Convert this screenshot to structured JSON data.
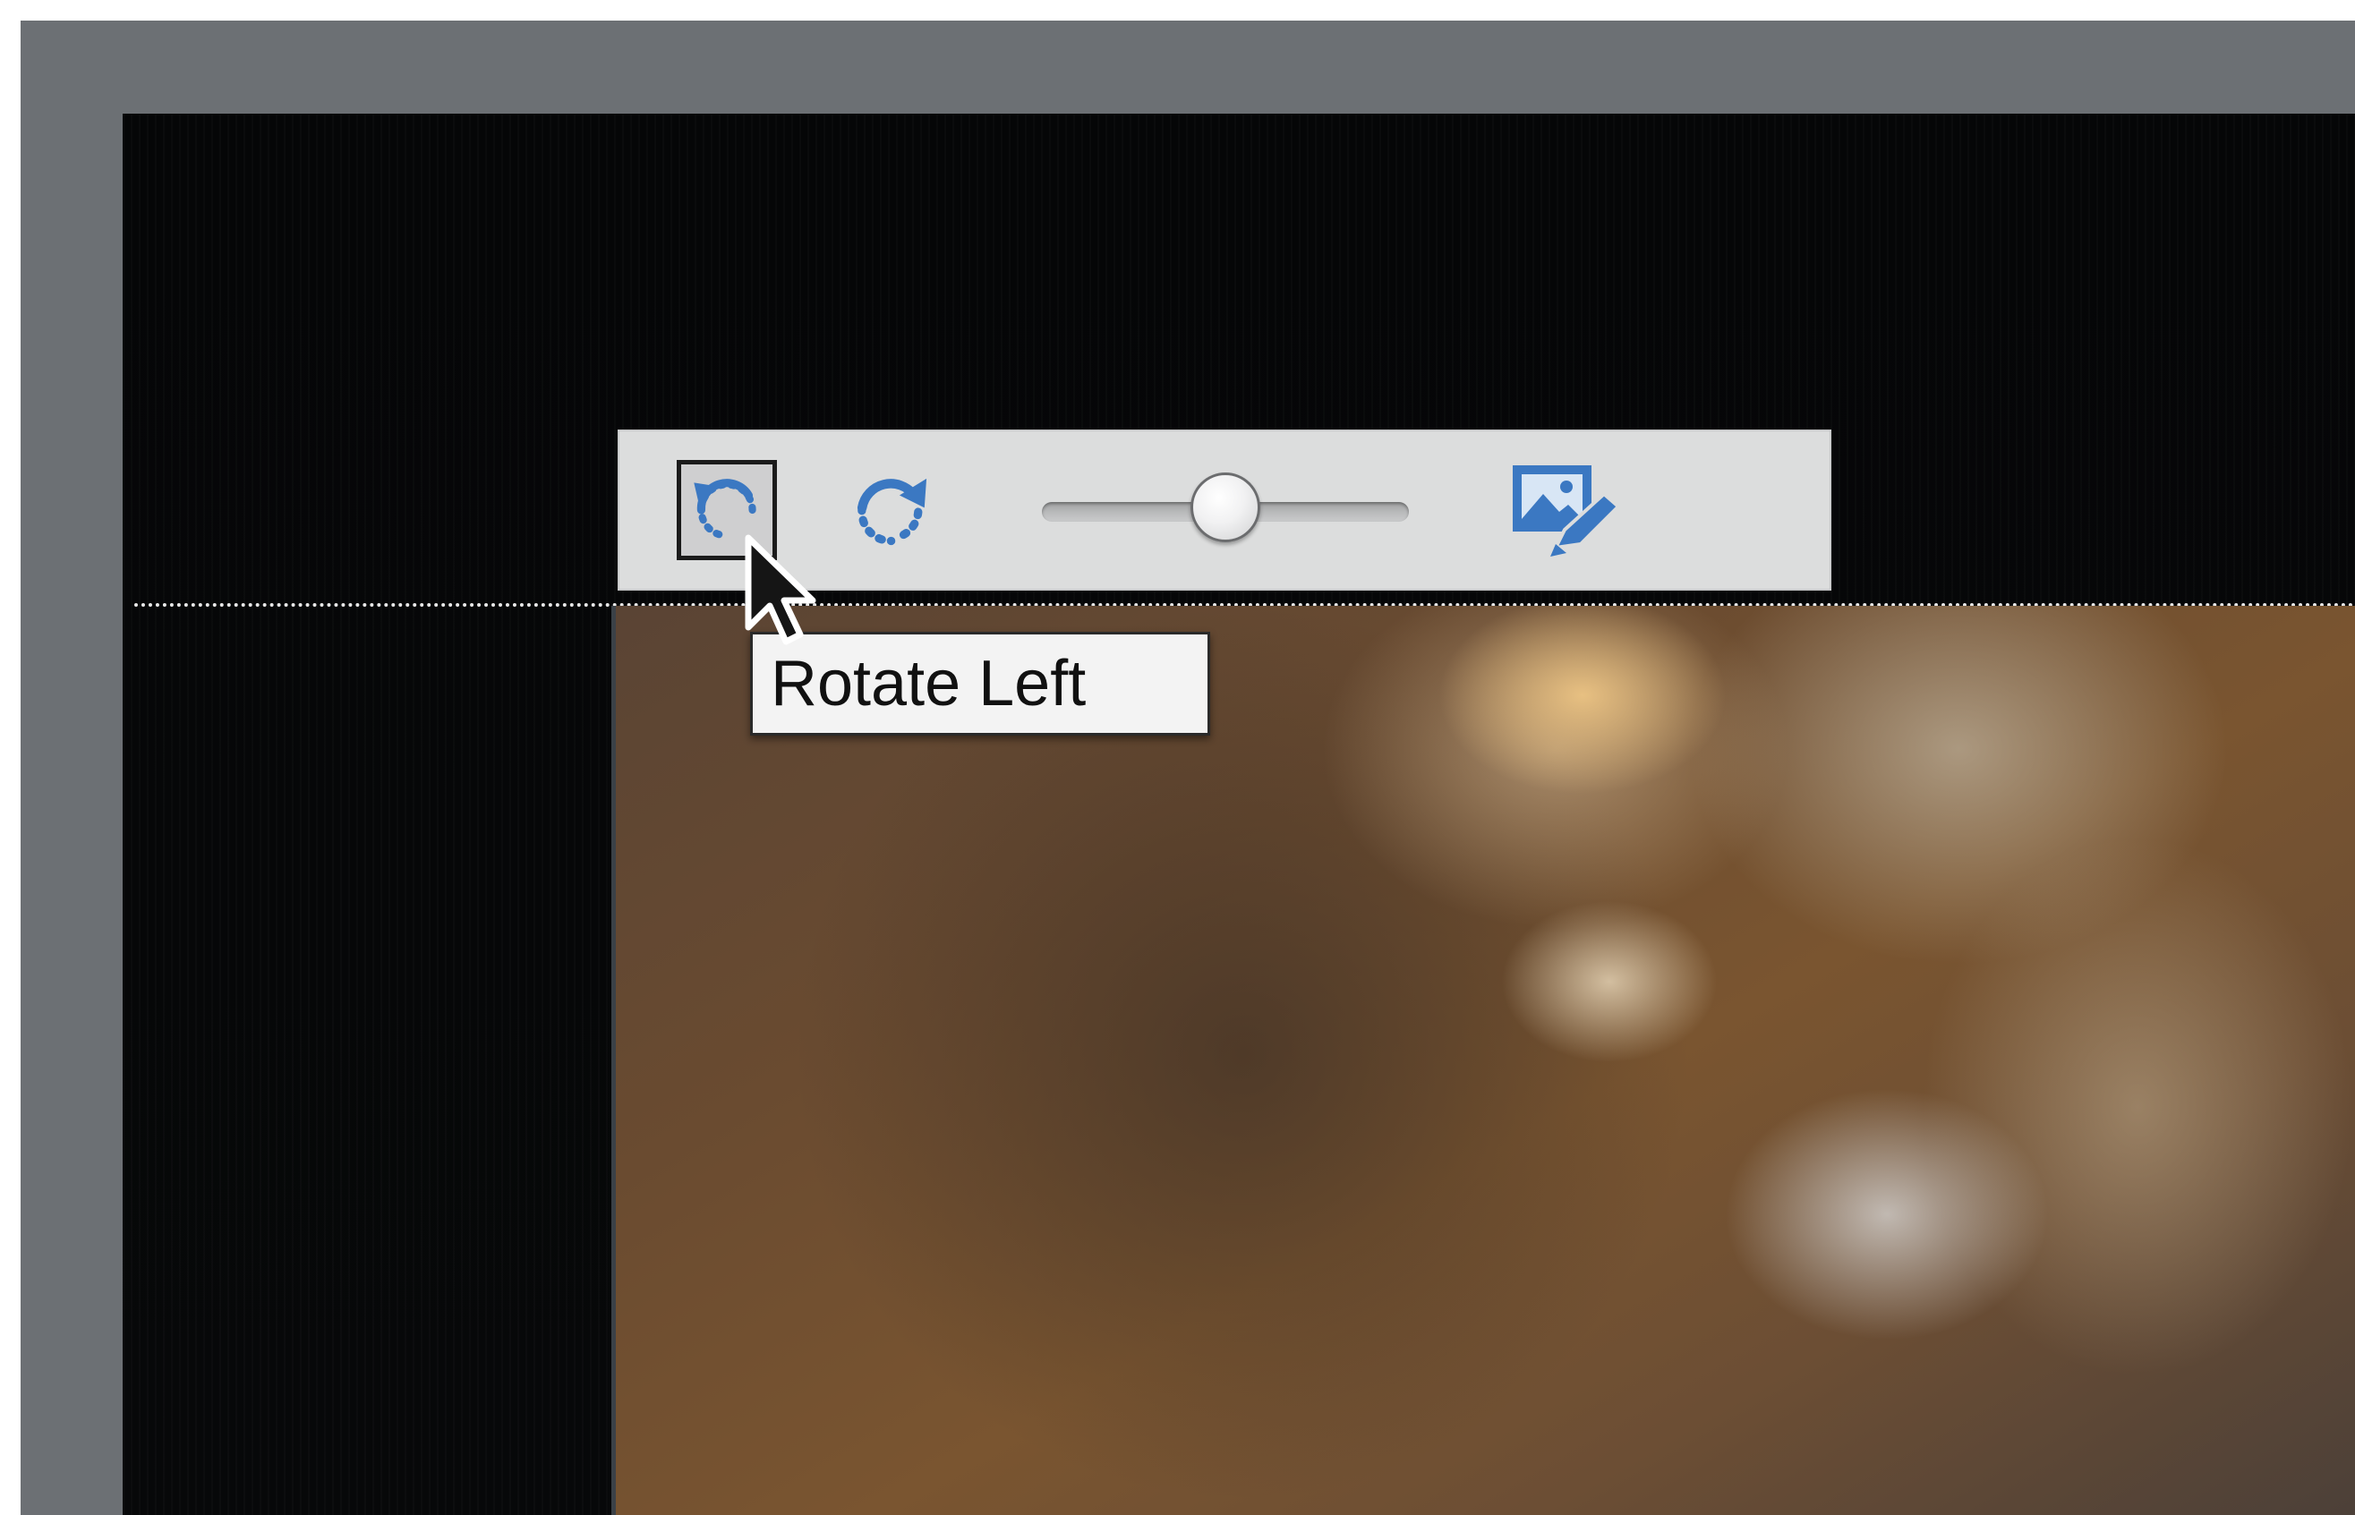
{
  "toolbar": {
    "buttons": [
      {
        "id": "rotate-left",
        "icon": "rotate-left-icon",
        "state": "hover"
      },
      {
        "id": "rotate-right",
        "icon": "rotate-right-icon"
      },
      {
        "id": "edit-image",
        "icon": "image-edit-icon"
      }
    ],
    "zoom_slider": {
      "value": 0.5
    }
  },
  "tooltip": {
    "text": "Rotate Left"
  },
  "colors": {
    "frame": "#6c7074",
    "canvas": "#050607",
    "toolbar": "#dcdddd",
    "icon_blue": "#3b78c2",
    "tooltip_bg": "#f3f3f3"
  }
}
